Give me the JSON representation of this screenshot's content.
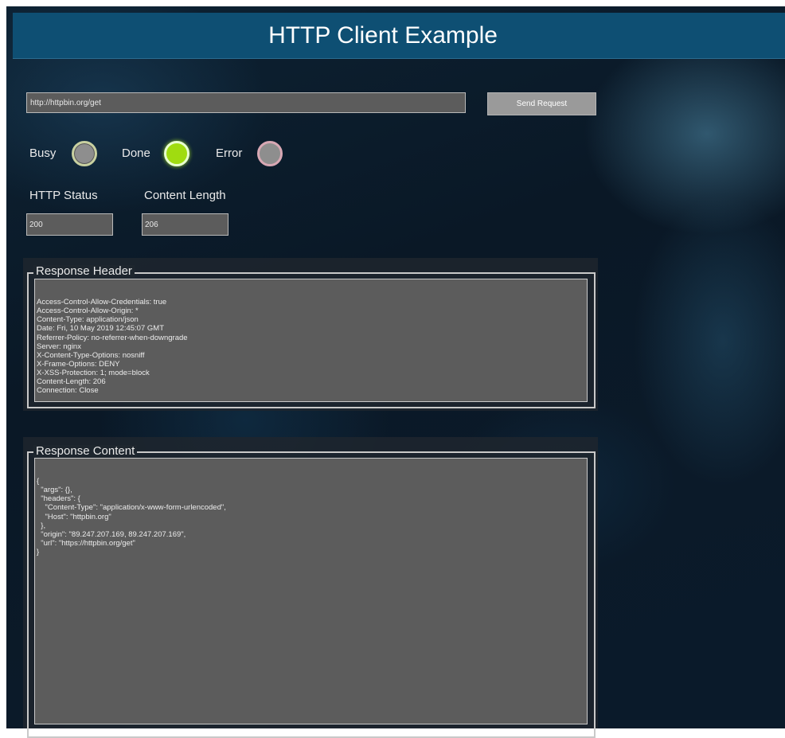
{
  "window": {
    "title": "HTTP Client Example"
  },
  "request": {
    "url": "http://httpbin.org/get",
    "send_label": "Send Request"
  },
  "indicators": {
    "busy_label": "Busy",
    "busy_state": "off",
    "done_label": "Done",
    "done_state": "on",
    "error_label": "Error",
    "error_state": "off",
    "on_color": "#a0dc10",
    "off_color": "#8e8e8e"
  },
  "status": {
    "http_status_label": "HTTP Status",
    "http_status_value": "200",
    "content_length_label": "Content Length",
    "content_length_value": "206"
  },
  "response_header": {
    "label": "Response Header",
    "lines": [
      "Access-Control-Allow-Credentials: true",
      "Access-Control-Allow-Origin: *",
      "Content-Type: application/json",
      "Date: Fri, 10 May 2019 12:45:07 GMT",
      "Referrer-Policy: no-referrer-when-downgrade",
      "Server: nginx",
      "X-Content-Type-Options: nosniff",
      "X-Frame-Options: DENY",
      "X-XSS-Protection: 1; mode=block",
      "Content-Length: 206",
      "Connection: Close"
    ]
  },
  "response_content": {
    "label": "Response Content",
    "lines": [
      "{",
      "  \"args\": {},",
      "  \"headers\": {",
      "    \"Content-Type\": \"application/x-www-form-urlencoded\",",
      "    \"Host\": \"httpbin.org\"",
      "  },",
      "  \"origin\": \"89.247.207.169, 89.247.207.169\",",
      "  \"url\": \"https://httpbin.org/get\"",
      "}"
    ]
  }
}
